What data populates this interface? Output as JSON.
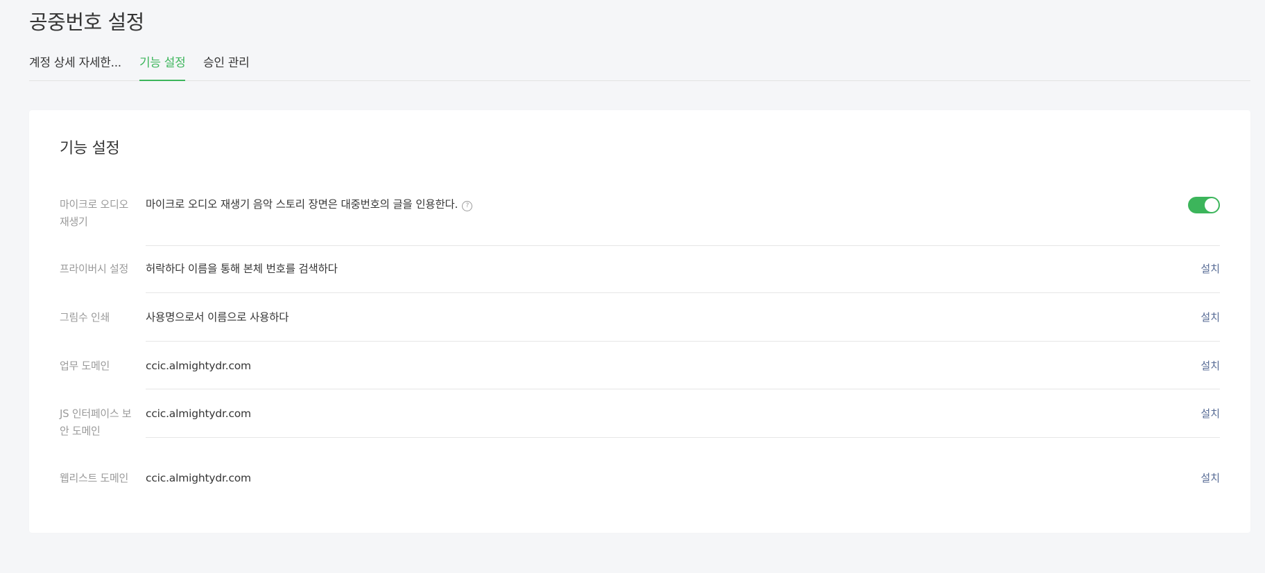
{
  "page": {
    "title": "공중번호 설정"
  },
  "tabs": [
    {
      "label": "계정 상세 자세한...",
      "active": false
    },
    {
      "label": "기능 설정",
      "active": true
    },
    {
      "label": "승인 관리",
      "active": false
    }
  ],
  "card": {
    "title": "기능 설정",
    "rows": [
      {
        "label": "마이크로 오디오 재생기",
        "value": "마이크로 오디오 재생기 음악 스토리 장면은 대중번호의 글을 인용한다.",
        "help_icon": "?",
        "toggle_on": true
      },
      {
        "label": "프라이버시 설정",
        "value": "허락하다 이름을 통해 본체 번호를 검색하다",
        "action": "설치"
      },
      {
        "label": "그림수 인쇄",
        "value": "사용명으로서 이름으로 사용하다",
        "action": "설치"
      },
      {
        "label": "업무 도메인",
        "value": "ccic.almightydr.com",
        "action": "설치"
      },
      {
        "label": "JS 인터페이스 보안 도메인",
        "value": "ccic.almightydr.com",
        "action": "설치"
      },
      {
        "label": "웹리스트 도메인",
        "value": "ccic.almightydr.com",
        "action": "설치"
      }
    ]
  },
  "colors": {
    "accent": "#3cb55b",
    "link": "#576b95",
    "background": "#f5f6f8"
  }
}
